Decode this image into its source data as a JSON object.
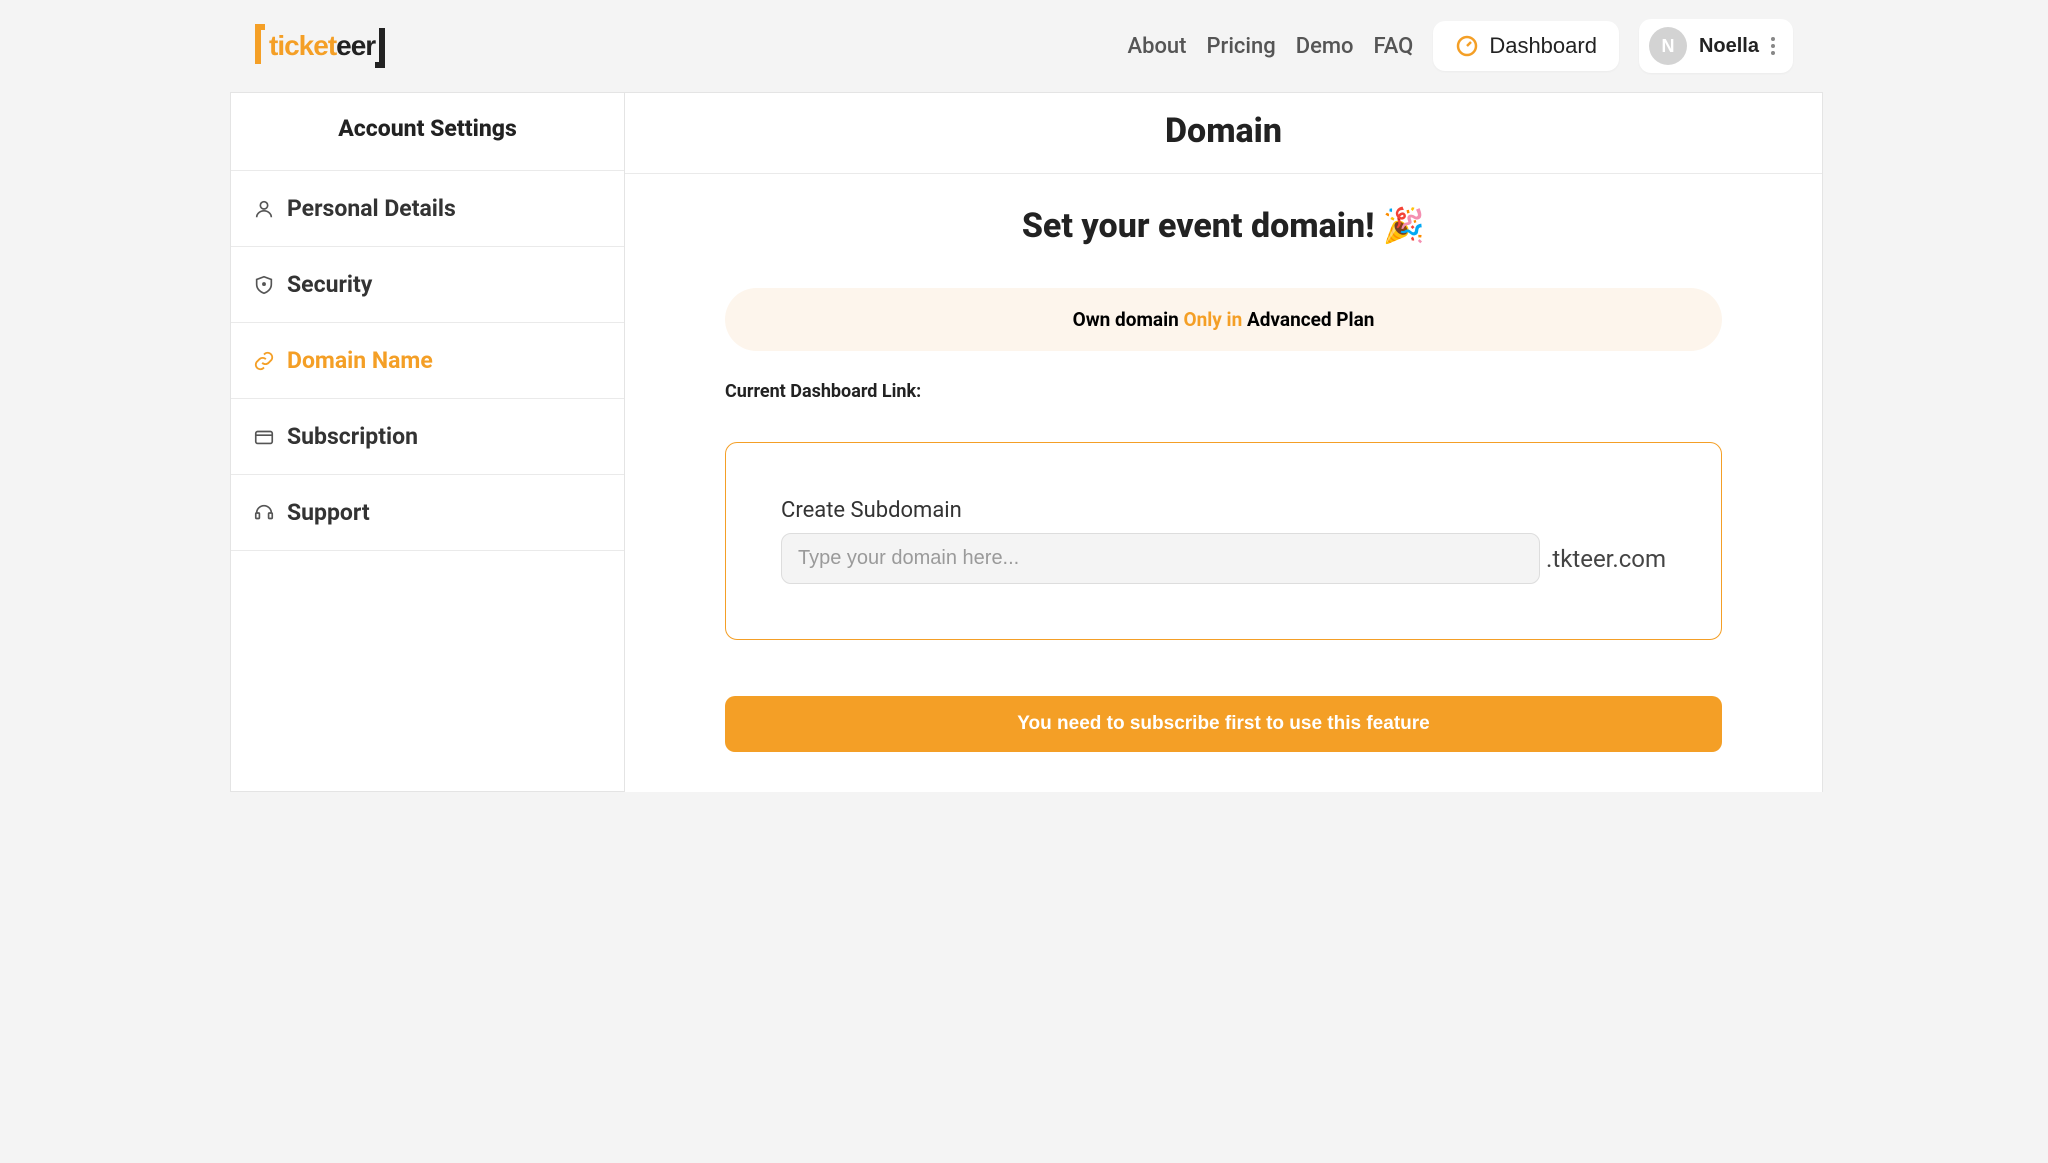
{
  "header": {
    "logo_tick": "tick",
    "logo_et": "et",
    "logo_eer": "eer",
    "nav": {
      "about": "About",
      "pricing": "Pricing",
      "demo": "Demo",
      "faq": "FAQ"
    },
    "dashboard_label": "Dashboard",
    "user_initial": "N",
    "user_name": "Noella"
  },
  "sidebar": {
    "title": "Account Settings",
    "items": {
      "personal": "Personal Details",
      "security": "Security",
      "domain": "Domain Name",
      "subscription": "Subscription",
      "support": "Support"
    }
  },
  "content": {
    "page_title": "Domain",
    "subtitle": "Set your event domain! 🎉",
    "notice_prefix": "Own domain ",
    "notice_highlight": "Only in",
    "notice_suffix": " Advanced Plan",
    "current_link_label": "Current Dashboard Link:",
    "field_label": "Create Subdomain",
    "input_placeholder": "Type your domain here...",
    "suffix": ".tkteer.com",
    "cta_label": "You need to subscribe first to use this feature"
  }
}
